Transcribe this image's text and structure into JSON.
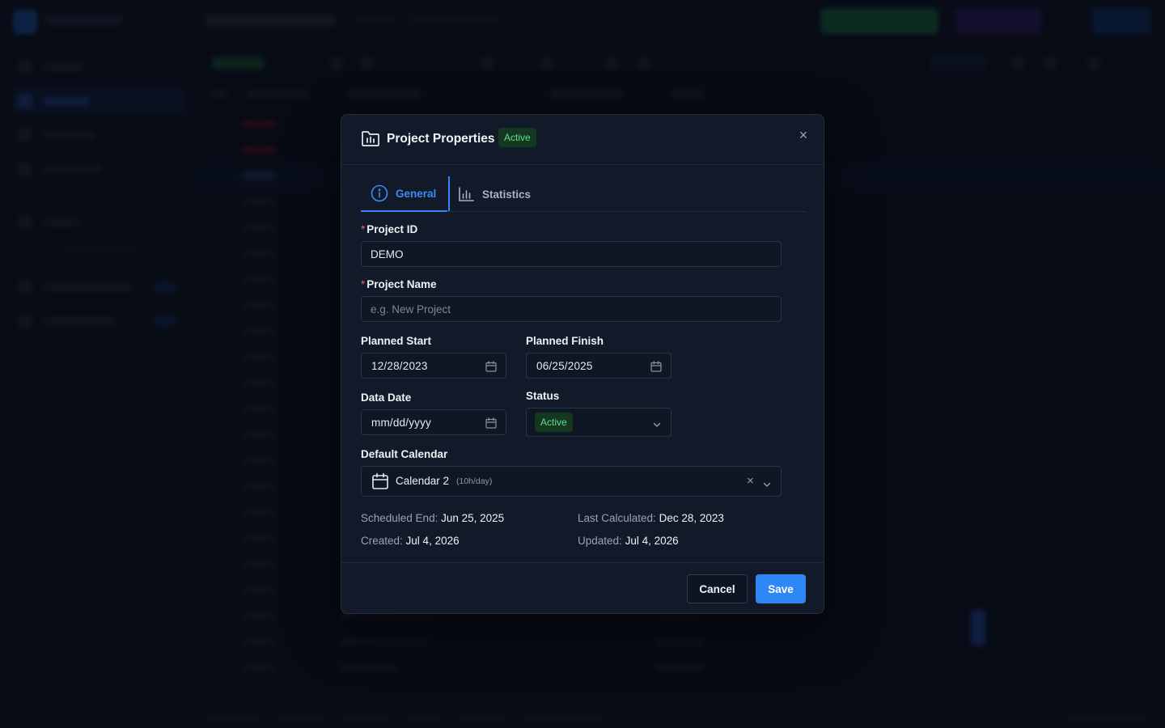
{
  "modal": {
    "title": "Project Properties",
    "status_badge": "Active",
    "close_symbol": "×",
    "tabs": [
      {
        "label": "General",
        "icon": "info-circle-icon",
        "active": true
      },
      {
        "label": "Statistics",
        "icon": "bar-chart-icon",
        "active": false
      }
    ],
    "fields": {
      "project_id": {
        "label": "Project ID",
        "required": "*",
        "value": "DEMO"
      },
      "project_name": {
        "label": "Project Name",
        "required": "*",
        "value": "",
        "placeholder": "e.g. New Project"
      },
      "planned_start": {
        "label": "Planned Start",
        "value": "12/28/2023"
      },
      "planned_finish": {
        "label": "Planned Finish",
        "value": "06/25/2025"
      },
      "data_date": {
        "label": "Data Date",
        "value": "mm/dd/yyyy"
      },
      "status": {
        "label": "Status",
        "value": "Active"
      },
      "default_calendar": {
        "label": "Default Calendar",
        "name": "Calendar 2",
        "meta": "(10h/day)",
        "clear_symbol": "×"
      }
    },
    "meta": {
      "scheduled_end": {
        "label": "Scheduled End:",
        "value": "Jun 25, 2025"
      },
      "last_calculated": {
        "label": "Last Calculated:",
        "value": "Dec 28, 2023"
      },
      "created": {
        "label": "Created:",
        "value": "Jul 4, 2026"
      },
      "updated": {
        "label": "Updated:",
        "value": "Jul 4, 2026"
      }
    },
    "footer": {
      "cancel_label": "Cancel",
      "save_label": "Save"
    }
  },
  "colors": {
    "accent": "#2f86f6",
    "success_bg": "#14371f",
    "success_text": "#5fe08a",
    "required": "#f25d5d",
    "modal_bg": "#121a29",
    "page_bg": "#0b111d"
  }
}
